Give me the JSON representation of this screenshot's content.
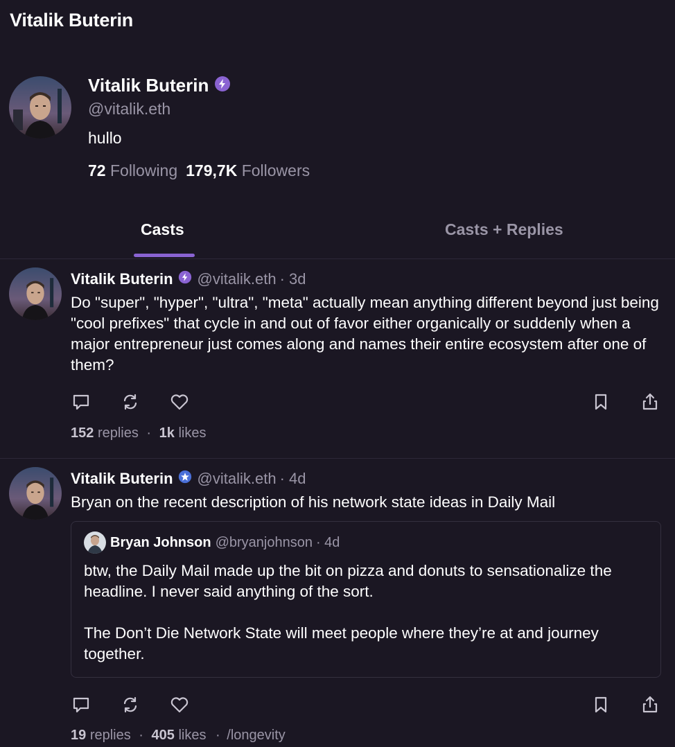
{
  "topbar": {
    "title": "Vitalik Buterin"
  },
  "profile": {
    "name": "Vitalik Buterin",
    "handle": "@vitalik.eth",
    "bio": "hullo",
    "following_count": "72",
    "following_label": "Following",
    "followers_count": "179,7K",
    "followers_label": "Followers",
    "badge_icon": "power-badge-icon"
  },
  "tabs": [
    {
      "label": "Casts",
      "active": true
    },
    {
      "label": "Casts + Replies",
      "active": false
    }
  ],
  "colors": {
    "background": "#1b1723",
    "accent": "#8a63d2",
    "muted_text": "#9a95a6",
    "divider": "#2d2838"
  },
  "posts": [
    {
      "author": "Vitalik Buterin",
      "handle": "@vitalik.eth",
      "time": "· 3d",
      "badge_icon": "power-badge-icon",
      "text": "Do \"super\", \"hyper\", \"ultra\", \"meta\" actually mean anything different beyond just being \"cool prefixes\" that cycle in and out of favor either organically or suddenly when a major entrepreneur just comes along and names their entire ecosystem after one of them?",
      "replies_count": "152",
      "replies_label": "replies",
      "likes_count": "1k",
      "likes_label": "likes",
      "separator": "·"
    },
    {
      "author": "Vitalik Buterin",
      "handle": "@vitalik.eth",
      "time": "· 4d",
      "badge_icon": "star-badge-icon",
      "text": "Bryan on the recent description of his network state ideas in Daily Mail",
      "quote": {
        "author": "Bryan Johnson",
        "handle": "@bryanjohnson",
        "time": "· 4d",
        "text": "btw, the Daily Mail made up the bit on pizza and donuts to sensationalize the headline. I never said anything of the sort.\n\nThe Don’t Die Network State will meet people where they’re at and journey together."
      },
      "replies_count": "19",
      "replies_label": "replies",
      "likes_count": "405",
      "likes_label": "likes",
      "separator": "·",
      "channel_separator": "·",
      "channel": "/longevity"
    }
  ],
  "action_icons": [
    "reply-icon",
    "recast-icon",
    "like-icon",
    "bookmark-icon",
    "share-icon"
  ]
}
